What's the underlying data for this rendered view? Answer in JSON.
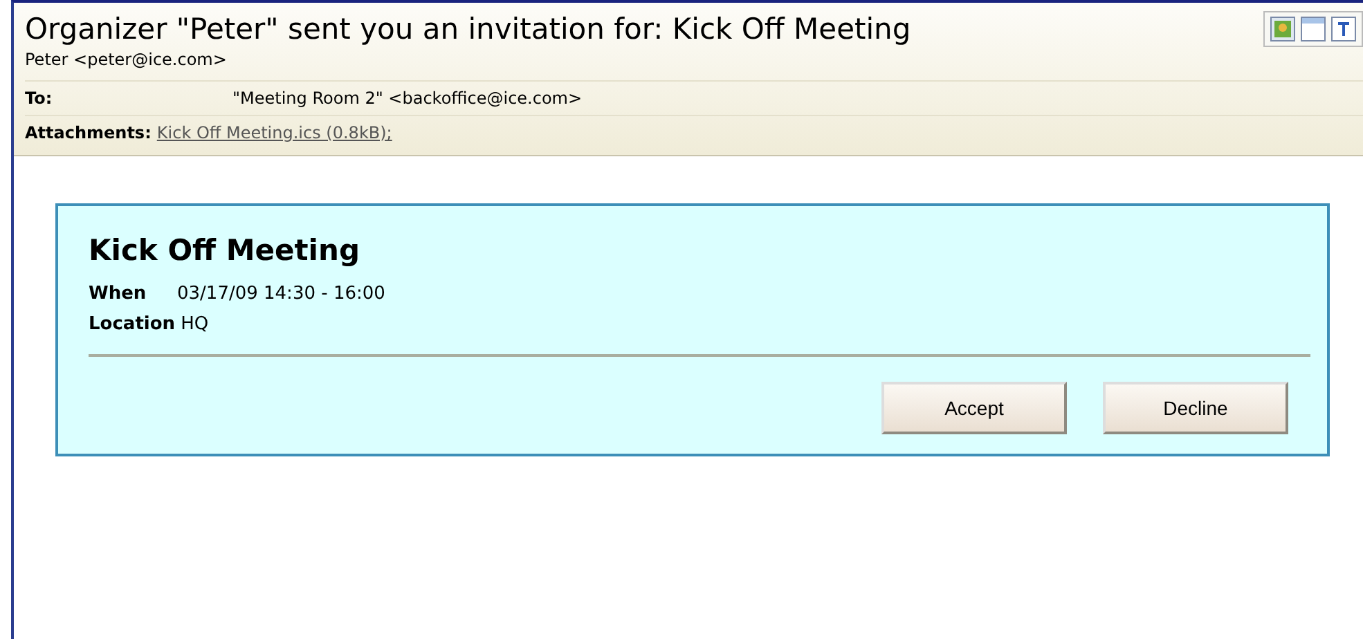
{
  "subject": "Organizer \"Peter\" sent you an invitation for: Kick Off Meeting",
  "from": "Peter <peter@ice.com>",
  "fields": [
    {
      "label": "To:",
      "kind": "text",
      "value": "\"Meeting Room 2\" <backoffice@ice.com>"
    },
    {
      "label": "Attachments:",
      "kind": "link",
      "value": "Kick Off Meeting.ics (0.8kB);"
    }
  ],
  "invitation": {
    "title": "Kick Off Meeting",
    "details": [
      {
        "label": "When",
        "value": "03/17/09 14:30 - 16:00"
      },
      {
        "label": "Location",
        "value": "HQ"
      }
    ],
    "buttons": [
      "Accept",
      "Decline"
    ]
  }
}
